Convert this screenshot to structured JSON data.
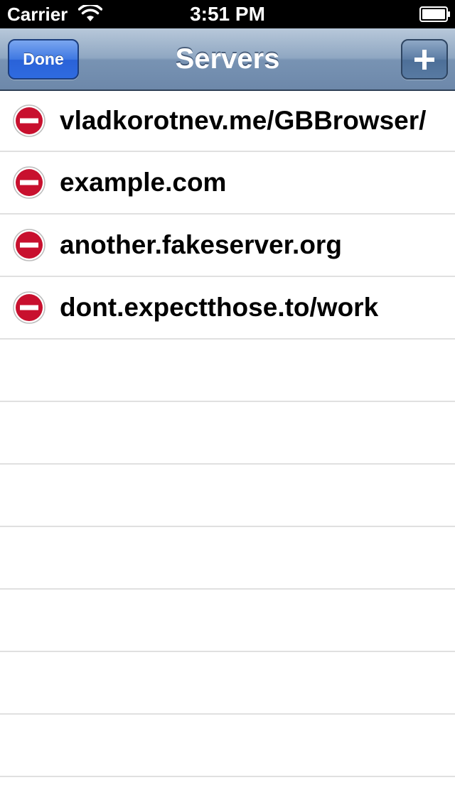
{
  "status_bar": {
    "carrier": "Carrier",
    "time": "3:51 PM",
    "icons": [
      "wifi-icon",
      "battery-icon"
    ]
  },
  "nav_bar": {
    "title": "Servers",
    "done_label": "Done",
    "add_icon": "plus-icon",
    "colors": {
      "done_button": "#2f6be0",
      "bar": "#7893b3"
    }
  },
  "servers": [
    {
      "label": "vladkorotnev.me/GBBrowser/"
    },
    {
      "label": "example.com"
    },
    {
      "label": "another.fakeserver.org"
    },
    {
      "label": "dont.expectthose.to/work"
    }
  ],
  "delete_control": {
    "icon": "minus-circle-icon",
    "color": "#c8102e"
  }
}
